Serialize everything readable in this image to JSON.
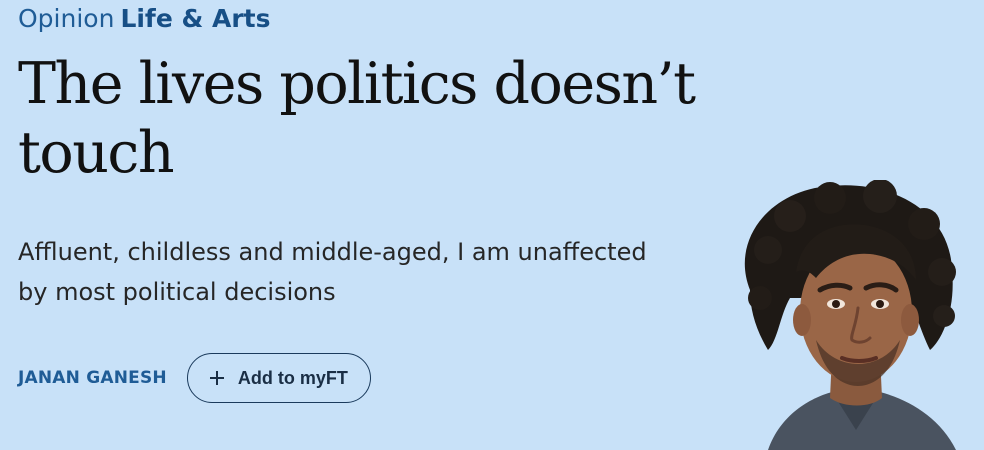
{
  "header": {
    "kicker": "Opinion",
    "section": "Life & Arts"
  },
  "article": {
    "headline": "The lives politics doesn’t touch",
    "standfirst": "Affluent, childless and middle-aged, I am unaffected by most political decisions",
    "author": "JANAN GANESH"
  },
  "actions": {
    "add_to_myft": "Add to myFT"
  },
  "colors": {
    "background": "#c8e1f8",
    "link_blue": "#1f5c96",
    "headline": "#111111"
  },
  "icons": {
    "add": "plus-icon",
    "author_image": "author-portrait"
  }
}
